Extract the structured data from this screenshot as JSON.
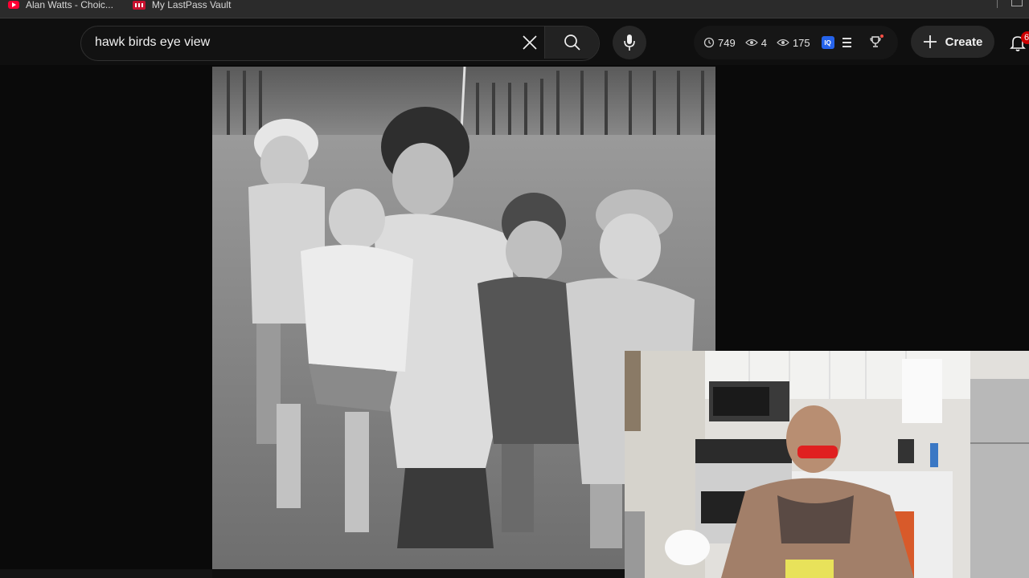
{
  "bookmarks": [
    {
      "label": "Alan Watts - Choic...",
      "icon": "youtube-icon"
    },
    {
      "label": "My LastPass Vault",
      "icon": "lastpass-icon"
    }
  ],
  "search": {
    "query": "hawk birds eye view"
  },
  "stats": {
    "watch_count": "749",
    "views_a": "4",
    "views_b": "175"
  },
  "create": {
    "label": "Create"
  },
  "notifications": {
    "badge": "6"
  },
  "colors": {
    "background": "#0f0f0f",
    "badge": "#cc0000",
    "extension": "#2563eb",
    "bookmark_yt": "#ff0033"
  }
}
